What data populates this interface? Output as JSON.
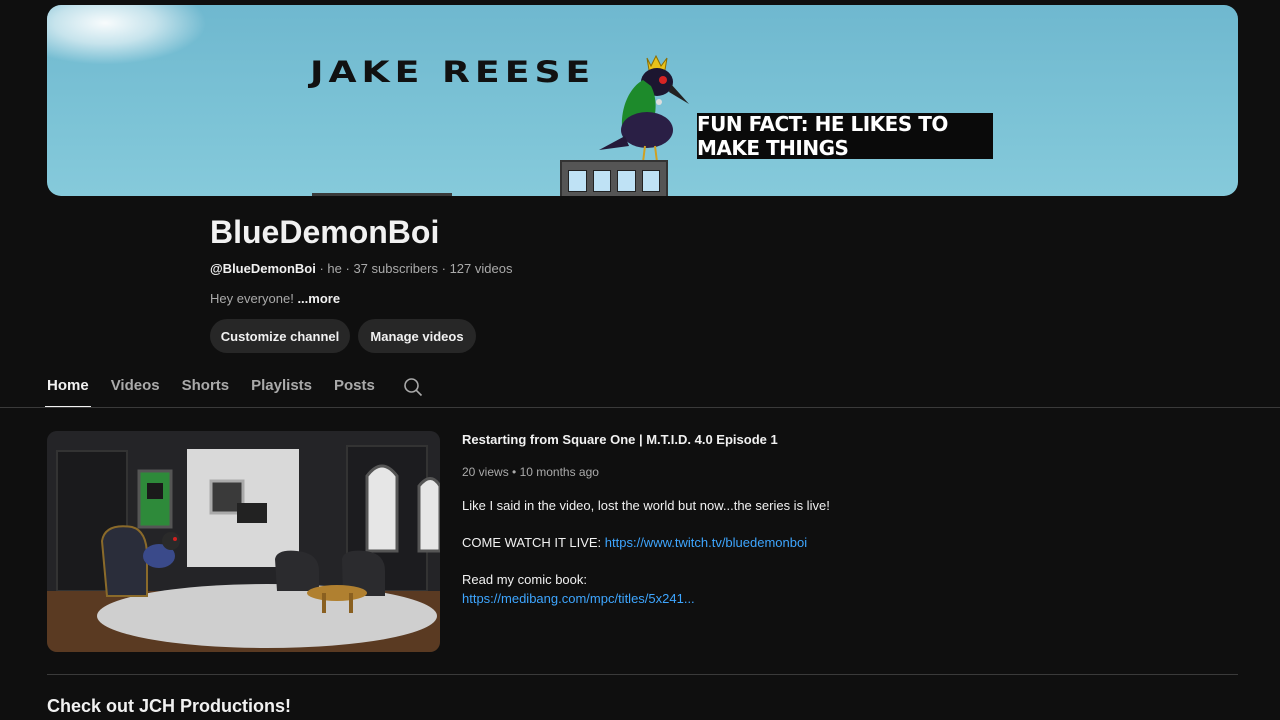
{
  "banner": {
    "title": "JAKE REESE",
    "fun_fact": "FUN FACT: HE LIKES TO MAKE THINGS"
  },
  "channel": {
    "name": "BlueDemonBoi",
    "handle": "@BlueDemonBoi",
    "pronouns": "he",
    "subscribers": "37 subscribers",
    "videos": "127 videos",
    "separator": " · ",
    "description": "Hey everyone! ",
    "more_label": "...more"
  },
  "actions": {
    "customize_label": "Customize channel",
    "manage_label": "Manage videos"
  },
  "tabs": [
    {
      "label": "Home",
      "active": true
    },
    {
      "label": "Videos",
      "active": false
    },
    {
      "label": "Shorts",
      "active": false
    },
    {
      "label": "Playlists",
      "active": false
    },
    {
      "label": "Posts",
      "active": false
    }
  ],
  "featured": {
    "title": "Restarting from Square One | M.T.I.D. 4.0 Episode 1",
    "views": "20 views",
    "age": "10 months ago",
    "dot": " • ",
    "desc_line1": "Like I said in the video, lost the world but now...the series is live!",
    "desc_live_prefix": "COME WATCH IT LIVE: ",
    "desc_live_link": "https://www.twitch.tv/bluedemonboi",
    "desc_comic_prefix": "Read my comic book:",
    "desc_comic_link": "https://medibang.com/mpc/titles/5x241..."
  },
  "section": {
    "title": "Check out JCH Productions!"
  },
  "colors": {
    "background": "#0f0f0f",
    "link": "#3ea6ff",
    "banner_sky": "#7cc3d6"
  }
}
